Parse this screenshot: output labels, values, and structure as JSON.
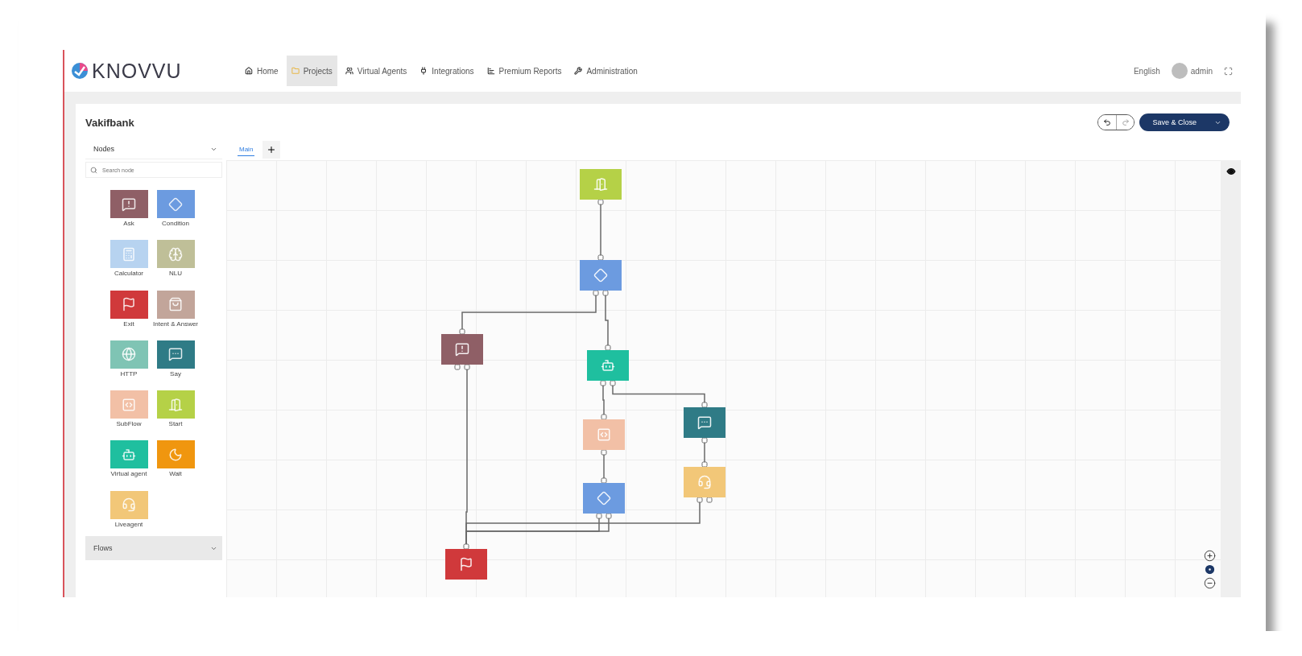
{
  "header": {
    "logo": "KNOVVU",
    "nav": [
      {
        "label": "Home",
        "selected": false
      },
      {
        "label": "Projects",
        "selected": true
      },
      {
        "label": "Virtual Agents",
        "selected": false
      },
      {
        "label": "Integrations",
        "selected": false
      },
      {
        "label": "Premium Reports",
        "selected": false
      },
      {
        "label": "Administration",
        "selected": false
      }
    ],
    "language": "English",
    "user": "admin"
  },
  "project": {
    "title": "Vakifbank",
    "save_button": "Save & Close"
  },
  "left_panel": {
    "section": "Nodes",
    "search": {
      "placeholder": "Search node"
    },
    "palette": [
      {
        "label": "Ask",
        "kind": "ask"
      },
      {
        "label": "Condition",
        "kind": "condition"
      },
      {
        "label": "Calculator",
        "kind": "calculator"
      },
      {
        "label": "NLU",
        "kind": "nlu"
      },
      {
        "label": "Exit",
        "kind": "end"
      },
      {
        "label": "Intent & Answer",
        "kind": "intent"
      },
      {
        "label": "HTTP",
        "kind": "http"
      },
      {
        "label": "Say",
        "kind": "say"
      },
      {
        "label": "SubFlow",
        "kind": "subflow"
      },
      {
        "label": "Start",
        "kind": "start"
      },
      {
        "label": "Virtual agent",
        "kind": "virtual_agent"
      },
      {
        "label": "Wait",
        "kind": "wait"
      },
      {
        "label": "Liveagent",
        "kind": "liveagent"
      }
    ],
    "flows": "Flows"
  },
  "tabs": [
    {
      "label": "Main",
      "selected": true
    }
  ],
  "canvas": {
    "nodes": [
      {
        "kind": "start"
      },
      {
        "kind": "condition"
      },
      {
        "kind": "ask"
      },
      {
        "kind": "virtual_agent"
      },
      {
        "kind": "subflow"
      },
      {
        "kind": "condition"
      },
      {
        "kind": "say"
      },
      {
        "kind": "liveagent"
      },
      {
        "kind": "end"
      }
    ]
  }
}
